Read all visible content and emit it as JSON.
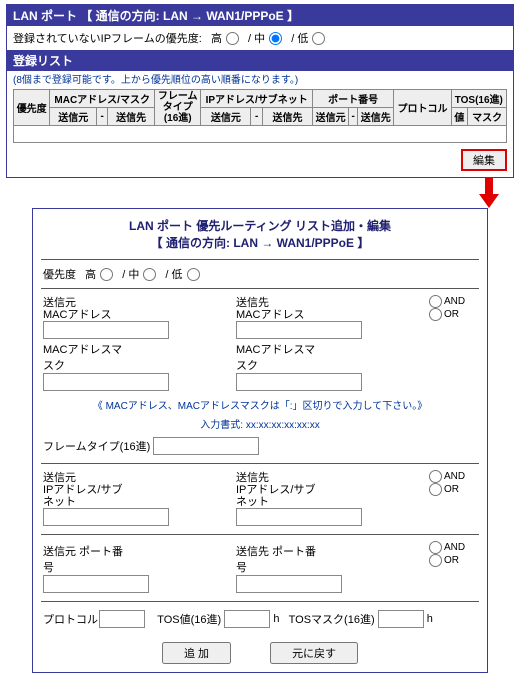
{
  "header": {
    "title": "LAN ポート 【 通信の方向: LAN → WAN1/PPPoE 】"
  },
  "unreg": {
    "label": "登録されていないIPフレームの優先度:",
    "hi": "高",
    "mid": "中",
    "lo": "低"
  },
  "list": {
    "title": "登録リスト",
    "note": "(8個まで登録可能です。上から優先順位の高い順番になります。)",
    "cols": {
      "prio": "優先度",
      "mac": "MACアドレス/マスク",
      "frame": "フレーム\nタイプ\n(16進)",
      "ip": "IPアドレス/サブネット",
      "port": "ポート番号",
      "proto": "プロトコル",
      "tos": "TOS(16進)",
      "src": "送信元",
      "dst": "送信先",
      "val": "値",
      "mask": "マスク"
    },
    "edit": "編集"
  },
  "editor": {
    "title1": "LAN ポート 優先ルーティング リスト追加・編集",
    "title2": "【 通信の方向: LAN → WAN1/PPPoE 】",
    "prio_label": "優先度",
    "hi": "高",
    "mid": "中",
    "lo": "低",
    "src_mac": "送信元\nMACアドレス",
    "dst_mac": "送信先\nMACアドレス",
    "mac_mask": "MACアドレスマスク",
    "mac_note1": "《 MACアドレス、MACアドレスマスクは「:」区切りで入力して下さい。》",
    "mac_note2": "入力書式: xx:xx:xx:xx:xx:xx",
    "frame": "フレームタイプ(16進)",
    "src_ip": "送信元\nIPアドレス/サブネット",
    "dst_ip": "送信先\nIPアドレス/サブネット",
    "src_port": "送信元 ポート番号",
    "dst_port": "送信先 ポート番号",
    "proto": "プロトコル",
    "tos_val": "TOS値(16進)",
    "tos_mask": "TOSマスク(16進)",
    "h": "h",
    "and": "AND",
    "or": "OR",
    "add": "追  加",
    "reset": "元に戻す"
  }
}
